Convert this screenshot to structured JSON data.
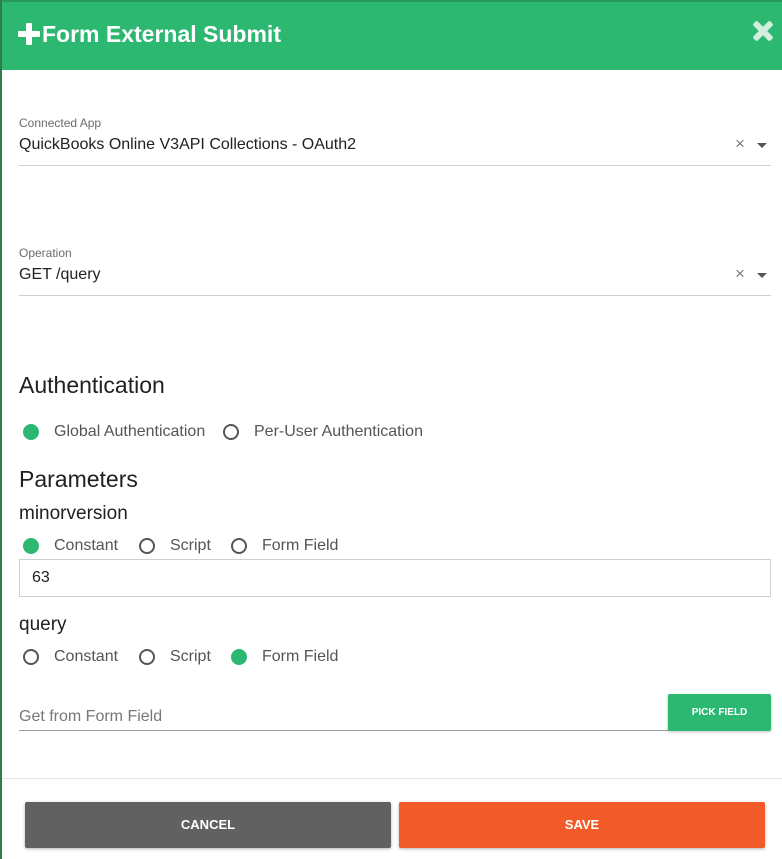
{
  "dialog": {
    "title": "Form External Submit",
    "icons": {
      "title_icon": "plus-icon",
      "close_icon": "close-icon"
    }
  },
  "connected_app": {
    "label": "Connected App",
    "value": "QuickBooks Online V3API Collections - OAuth2",
    "clear_symbol": "×"
  },
  "operation": {
    "label": "Operation",
    "value": "GET /query",
    "clear_symbol": "×"
  },
  "authentication": {
    "heading": "Authentication",
    "options": [
      "Global Authentication",
      "Per-User Authentication"
    ],
    "selected": "Global Authentication"
  },
  "parameters": {
    "heading": "Parameters",
    "minorversion": {
      "name": "minorversion",
      "options": [
        "Constant",
        "Script",
        "Form Field"
      ],
      "selected": "Constant",
      "value": "63"
    },
    "query": {
      "name": "query",
      "options": [
        "Constant",
        "Script",
        "Form Field"
      ],
      "selected": "Form Field",
      "placeholder": "Get from Form Field",
      "pick_button": "PICK FIELD"
    }
  },
  "footer": {
    "cancel_label": "CANCEL",
    "save_label": "SAVE"
  },
  "colors": {
    "accent_green": "#2db872",
    "save_orange": "#f15a29",
    "cancel_gray": "#616161"
  }
}
